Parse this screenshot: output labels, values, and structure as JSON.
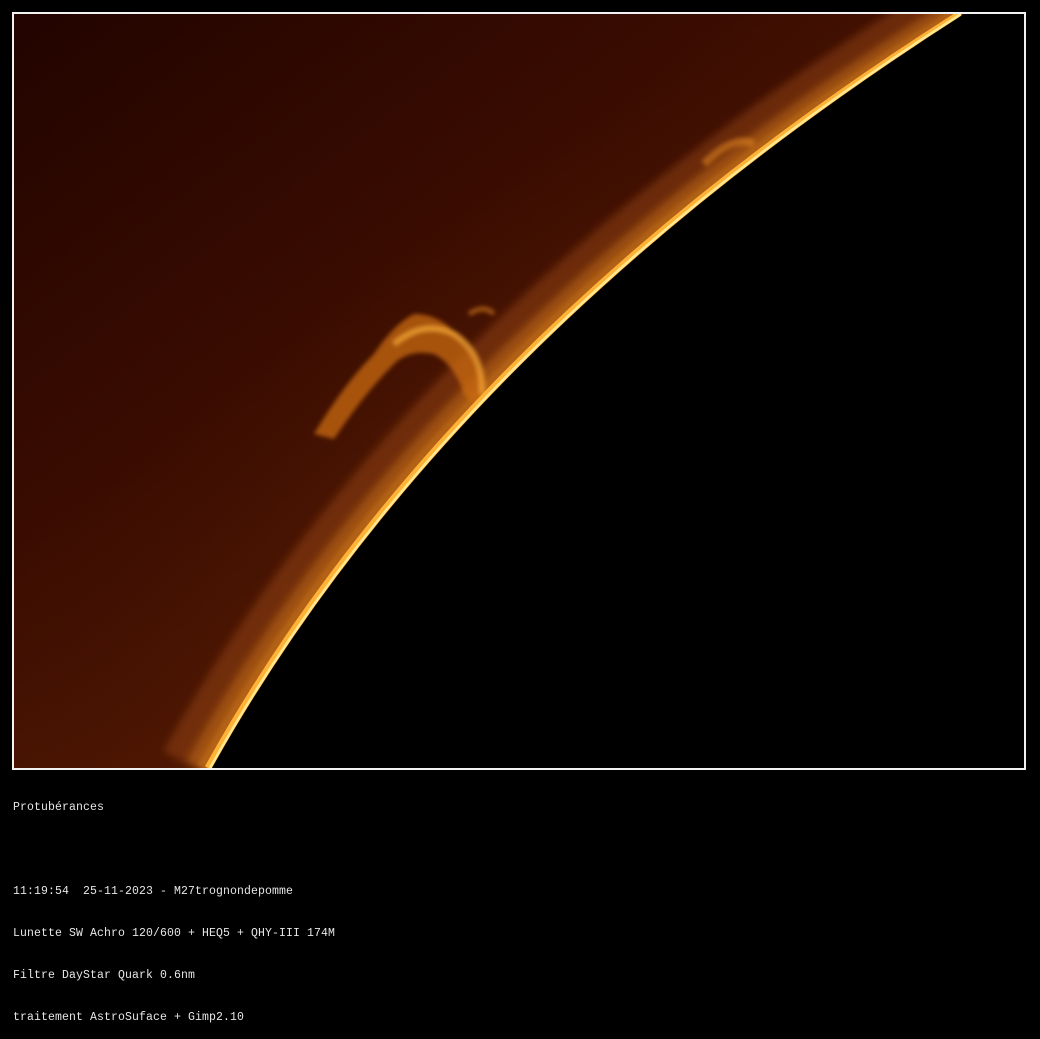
{
  "image": {
    "subject": "solar-limb-prominences",
    "colors": {
      "sky_dark": "#2a0600",
      "sky_mid": "#5a1c02",
      "limb_bright": "#ffc24a",
      "limb_core": "#fff0a8",
      "disk": "#000000",
      "frame": "#f2f2f2"
    }
  },
  "caption": {
    "title": "Protubérances",
    "blank": "",
    "line1": "11:19:54  25-11-2023 - M27trognondepomme",
    "line2": "Lunette SW Achro 120/600 + HEQ5 + QHY-III 174M",
    "line3": "Filtre DayStar Quark 0.6nm",
    "line4": "traitement AstroSuface + Gimp2.10"
  }
}
